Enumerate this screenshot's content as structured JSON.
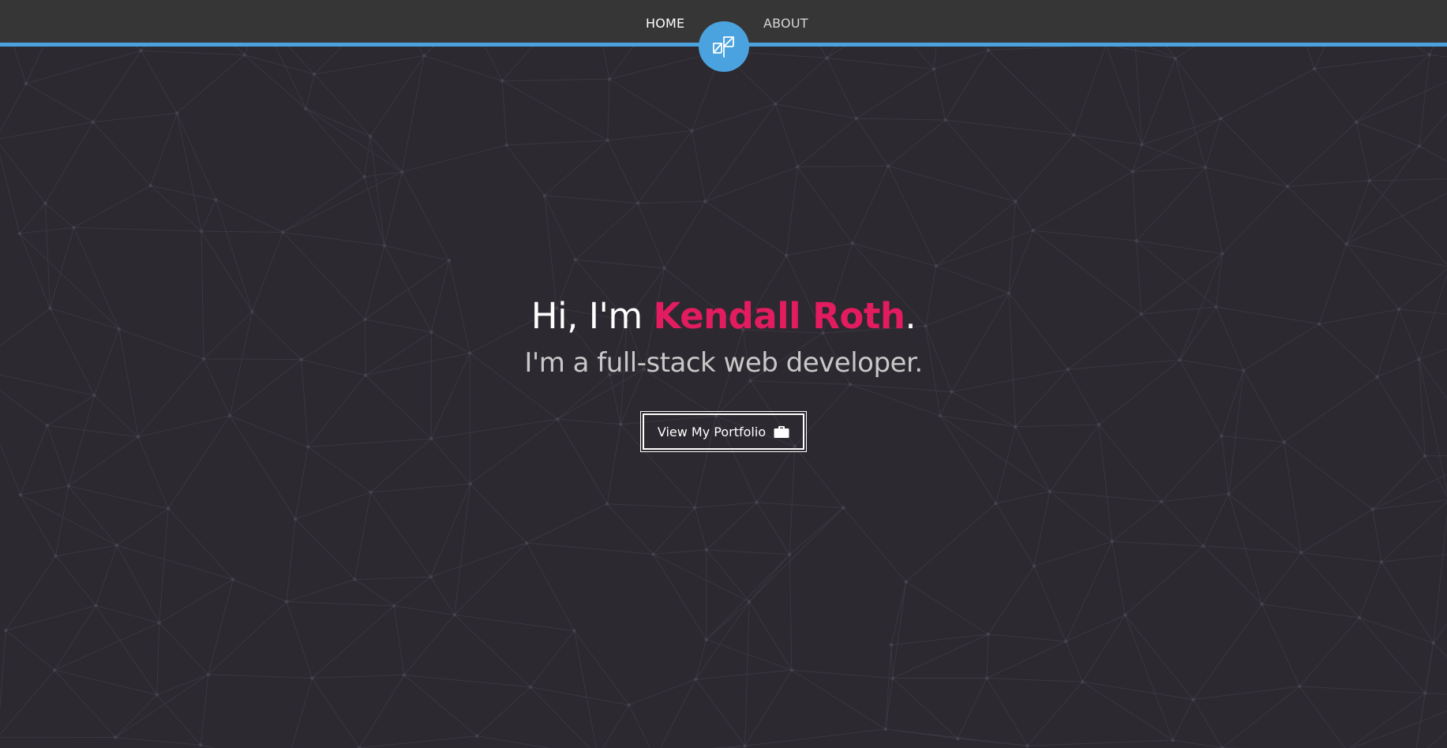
{
  "nav": {
    "home_label": "HOME",
    "about_label": "ABOUT",
    "logo_icon": "sprout-leaf-icon"
  },
  "hero": {
    "greeting": "Hi, I'm ",
    "name": "Kendall Roth",
    "period": ".",
    "subtitle": "I'm a full-stack web developer.",
    "button_label": "View My Portfolio",
    "button_icon": "briefcase-icon"
  },
  "colors": {
    "background": "#2c2930",
    "navbar": "#363636",
    "accent_blue": "#4aa3df",
    "name_pink": "#e31b5f",
    "text_white": "#ffffff",
    "subtitle_gray": "#c8c8c8"
  }
}
